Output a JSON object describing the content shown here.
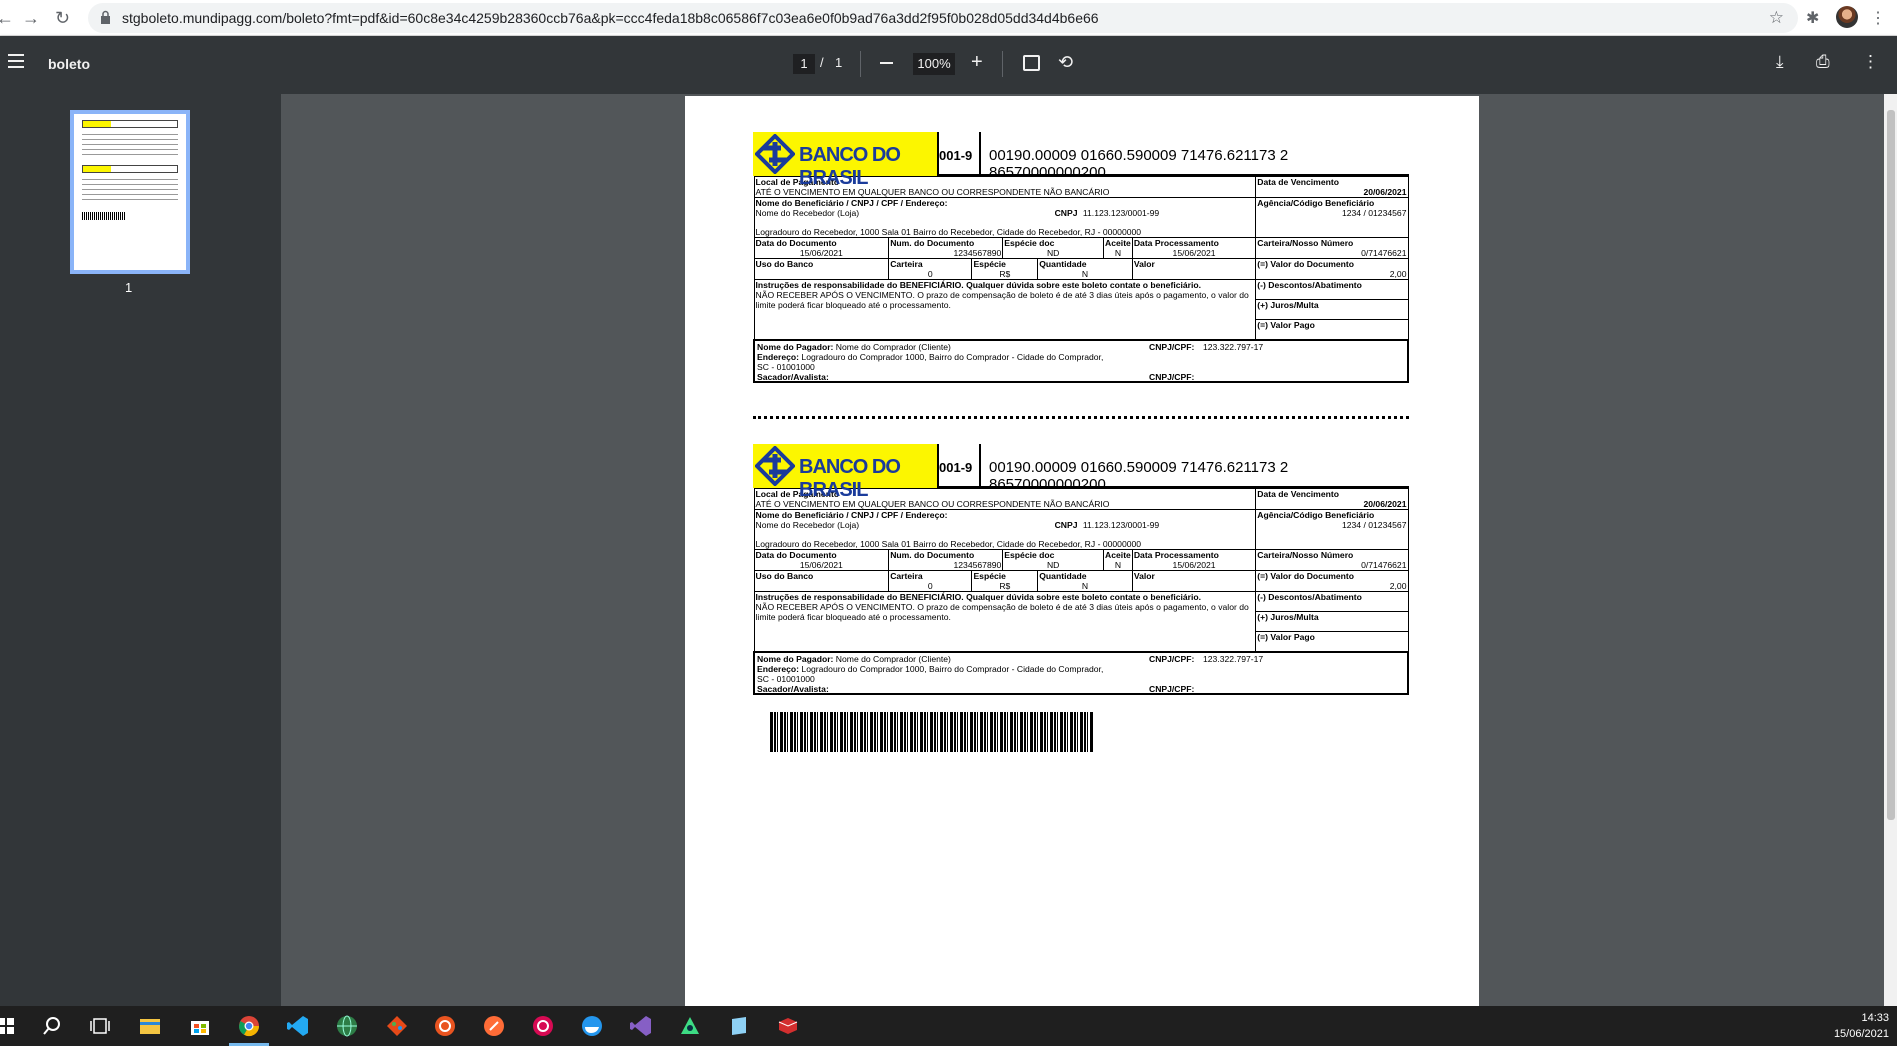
{
  "browser": {
    "url": "stgboleto.mundipagg.com/boleto?fmt=pdf&id=60c8e34c4259b28360ccb76a&pk=ccc4feda18b8c06586f7c03ea6e0f0b9ad76a3dd2f95f0b028d05dd34d4b6e66"
  },
  "pdf_toolbar": {
    "title": "boleto",
    "current_page": "1",
    "separator": "/",
    "total_pages": "1",
    "zoom": "100%"
  },
  "sidebar": {
    "thumb_label": "1"
  },
  "boleto": {
    "bank_name": "BANCO DO BRASIL",
    "bank_code": "001-9",
    "digitable_line": "00190.00009 01660.590009 71476.621173 2 86570000000200",
    "local_pagamento_label": "Local de Pagamento",
    "local_pagamento_value": "ATÉ O VENCIMENTO EM QUALQUER BANCO OU CORRESPONDENTE NÃO BANCÁRIO",
    "vencimento_label": "Data de Vencimento",
    "vencimento_value": "20/06/2021",
    "beneficiario_label": "Nome do Beneficiário / CNPJ / CPF / Endereço:",
    "beneficiario_name": "Nome do Recebedor (Loja)",
    "cnpj_label": "CNPJ",
    "cnpj_value": "11.123.123/0001-99",
    "beneficiario_address": "Logradouro do Recebedor, 1000 Sala 01 Bairro do Recebedor, Cidade do Recebedor, RJ - 00000000",
    "agencia_label": "Agência/Código Beneficiário",
    "agencia_value": "1234 / 01234567",
    "data_doc_label": "Data do Documento",
    "data_doc_value": "15/06/2021",
    "num_doc_label": "Num. do Documento",
    "num_doc_value": "1234567890",
    "especie_doc_label": "Espécie doc",
    "especie_doc_value": "ND",
    "aceite_label": "Aceite",
    "aceite_value": "N",
    "data_proc_label": "Data Processamento",
    "data_proc_value": "15/06/2021",
    "nosso_num_label": "Carteira/Nosso Número",
    "nosso_num_value": "0/71476621",
    "uso_banco_label": "Uso do Banco",
    "carteira_label": "Carteira",
    "carteira_value": "0",
    "especie_label": "Espécie",
    "especie_value": "R$",
    "quantidade_label": "Quantidade",
    "quantidade_value": "N",
    "valor_label": "Valor",
    "valor_doc_label": "(=) Valor do Documento",
    "valor_doc_value": "2,00",
    "instrucoes_label": "Instruções de responsabilidade do BENEFICIÁRIO. Qualquer dúvida sobre este boleto contate o beneficiário.",
    "instrucoes_value": "NÃO RECEBER APÓS O VENCIMENTO. O prazo de compensação de boleto é de até 3 dias úteis após o pagamento, o valor do limite poderá ficar bloqueado até o processamento.",
    "descontos_label": "(-) Descontos/Abatimento",
    "juros_label": "(+) Juros/Multa",
    "valor_pago_label": "(=) Valor Pago",
    "pagador_label": "Nome do Pagador:",
    "pagador_value": "Nome do Comprador (Cliente)",
    "pagador_cpf_label": "CNPJ/CPF:",
    "pagador_cpf_value": "123.322.797-17",
    "endereco_label": "Endereço:",
    "endereco_value": "Logradouro do Comprador 1000, Bairro do Comprador - Cidade do Comprador, SC - 01001000",
    "sacador_label": "Sacador/Avalista:",
    "sacador_cpf_label": "CNPJ/CPF:"
  },
  "taskbar": {
    "time": "14:33",
    "date": "15/06/2021",
    "icons": [
      "windows-start-icon",
      "search-icon",
      "task-view-icon",
      "file-explorer-icon",
      "store-icon",
      "chrome-icon",
      "vscode-icon",
      "globe-app-icon",
      "git-icon",
      "ubuntu-icon",
      "postman-icon",
      "debian-icon",
      "docker-icon",
      "visual-studio-icon",
      "android-studio-icon",
      "notepad-icon",
      "terminal-icon"
    ]
  },
  "colors": {
    "bank_yellow": "#fcf600",
    "bank_blue": "#1a3b9b",
    "pdf_toolbar": "#323639",
    "viewer_bg": "#525659"
  }
}
